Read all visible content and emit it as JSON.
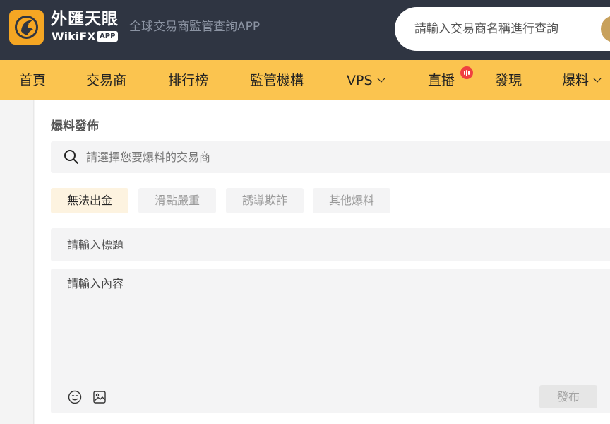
{
  "header": {
    "logo_cn": "外匯天眼",
    "logo_en": "WikiFX",
    "logo_badge": "APP",
    "slogan": "全球交易商監管查詢APP",
    "search_placeholder": "請輸入交易商名稱進行查詢"
  },
  "nav": {
    "items": [
      {
        "label": "首頁",
        "dropdown": false
      },
      {
        "label": "交易商",
        "dropdown": false
      },
      {
        "label": "排行榜",
        "dropdown": false
      },
      {
        "label": "監管機構",
        "dropdown": false
      },
      {
        "label": "VPS",
        "dropdown": true
      },
      {
        "label": "直播",
        "dropdown": false,
        "badge": "live-icon"
      },
      {
        "label": "發現",
        "dropdown": false
      },
      {
        "label": "爆料",
        "dropdown": true
      }
    ]
  },
  "form": {
    "section_title": "爆料發佈",
    "broker_placeholder": "請選擇您要爆料的交易商",
    "categories": [
      {
        "label": "無法出金",
        "selected": true
      },
      {
        "label": "滑點嚴重",
        "selected": false
      },
      {
        "label": "誘導欺詐",
        "selected": false
      },
      {
        "label": "其他爆料",
        "selected": false
      }
    ],
    "title_placeholder": "請輸入標題",
    "content_placeholder": "請輸入內容",
    "publish_label": "發布"
  },
  "colors": {
    "header_bg": "#2f3542",
    "nav_bg": "#fbc44f",
    "logo_bg": "#f5a623",
    "active_tag_bg": "#fdf3e0",
    "badge_red": "#f04040"
  }
}
